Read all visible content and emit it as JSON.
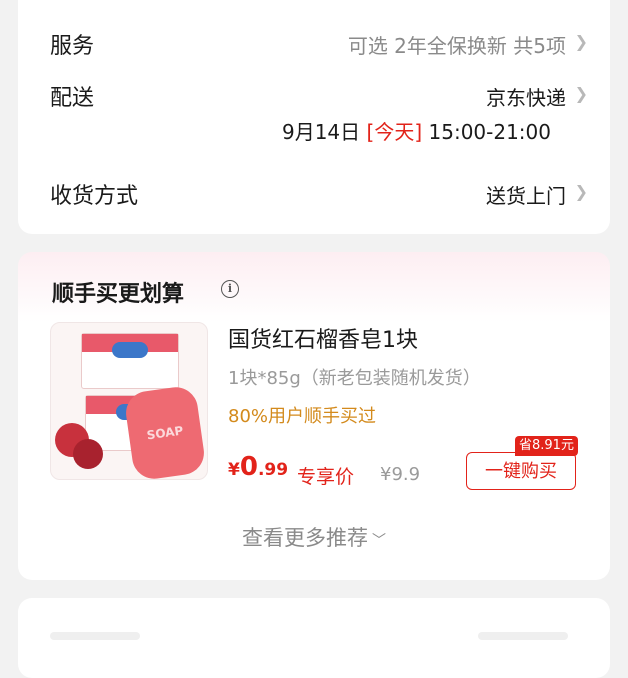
{
  "service": {
    "label": "服务",
    "value": "可选 2年全保换新 共5项",
    "chevron_icon": "chevron-right-icon"
  },
  "delivery": {
    "label": "配送",
    "carrier": "京东快递",
    "date": "9月14日",
    "day_tag": "[今天]",
    "time_range": "15:00-21:00",
    "chevron_icon": "chevron-right-icon"
  },
  "receive": {
    "label": "收货方式",
    "value": "送货上门",
    "chevron_icon": "chevron-right-icon"
  },
  "addon": {
    "title": "顺手买更划算",
    "info_icon": "info-icon",
    "product": {
      "name": "国货红石榴香皂1块",
      "spec": "1块*85g（新老包装随机发货）",
      "popularity": "80%用户顺手买过",
      "price_currency": "¥",
      "price_int": "0",
      "price_dec": ".99",
      "price_tag": "专享价",
      "original_price": "¥9.9",
      "save_badge": "省8.91元",
      "buy_button": "一键购买",
      "image_text": "SOAP"
    },
    "more_label": "查看更多推荐",
    "more_icon": "chevron-down-icon"
  },
  "colors": {
    "accent_red": "#e2231a",
    "popularity_orange": "#d38a1c",
    "muted_gray": "#8a8a8a",
    "background": "#f2f2f2"
  }
}
